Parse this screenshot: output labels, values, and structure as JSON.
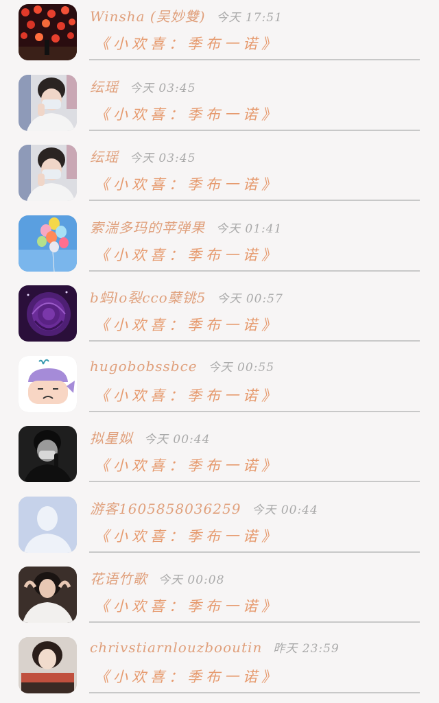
{
  "comments": [
    {
      "name": "Winsha (吴妙雙)",
      "time": "今天 17:51",
      "message": "《小欢喜：季布一诺》",
      "avatar": "red-lanterns-avatar"
    },
    {
      "name": "纭瑶",
      "time": "今天 03:45",
      "message": "《小欢喜：季布一诺》",
      "avatar": "masked-man-avatar"
    },
    {
      "name": "纭瑶",
      "time": "今天 03:45",
      "message": "《小欢喜：季布一诺》",
      "avatar": "masked-man-avatar"
    },
    {
      "name": "索湍多玛的苹弹果",
      "time": "今天 01:41",
      "message": "《小欢喜：季布一诺》",
      "avatar": "balloons-avatar"
    },
    {
      "name": "b蚂lo裂cco蘖铫5",
      "time": "今天 00:57",
      "message": "《小欢喜：季布一诺》",
      "avatar": "purple-rose-avatar"
    },
    {
      "name": "hugobobssbce",
      "time": "今天 00:55",
      "message": "《小欢喜：季布一诺》",
      "avatar": "cartoon-whale-avatar"
    },
    {
      "name": "拟星姒",
      "time": "今天 00:44",
      "message": "《小欢喜：季布一诺》",
      "avatar": "bw-portrait-avatar"
    },
    {
      "name": "游客1605858036259",
      "time": "今天 00:44",
      "message": "《小欢喜：季布一诺》",
      "avatar": "default-user-avatar"
    },
    {
      "name": "花语竹歌",
      "time": "今天 00:08",
      "message": "《小欢喜：季布一诺》",
      "avatar": "woman-portrait-avatar"
    },
    {
      "name": "chrivstiarnlouzbooutin",
      "time": "昨天 23:59",
      "message": "《小欢喜：季布一诺》",
      "avatar": "girl-portrait-avatar"
    }
  ]
}
